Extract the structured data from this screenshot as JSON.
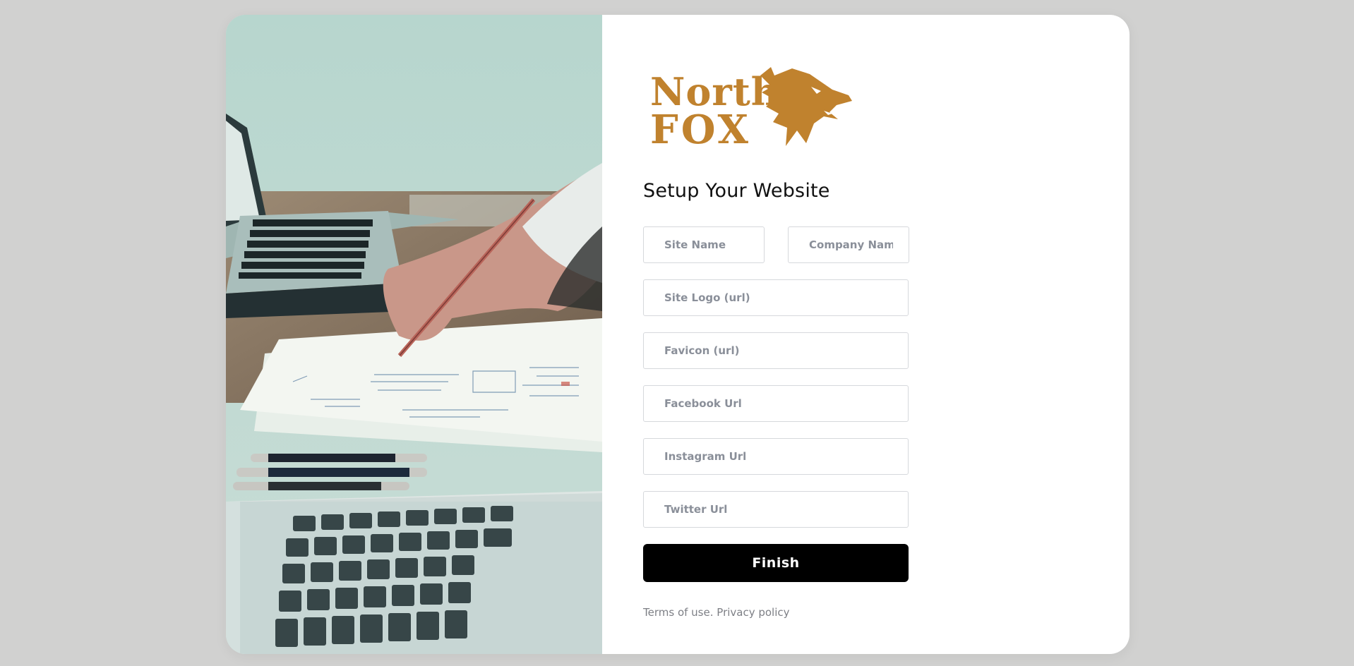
{
  "brand": {
    "logo_line1": "North",
    "logo_line2": "FOX",
    "logo_color": "#c0822e"
  },
  "page": {
    "heading": "Setup Your Website"
  },
  "form": {
    "site_name": {
      "placeholder": "Site Name",
      "value": ""
    },
    "company_name": {
      "placeholder": "Company Name",
      "value": ""
    },
    "site_logo": {
      "placeholder": "Site Logo (url)",
      "value": ""
    },
    "favicon": {
      "placeholder": "Favicon (url)",
      "value": ""
    },
    "facebook": {
      "placeholder": "Facebook Url",
      "value": ""
    },
    "instagram": {
      "placeholder": "Instagram Url",
      "value": ""
    },
    "twitter": {
      "placeholder": "Twitter Url",
      "value": ""
    },
    "submit_label": "Finish"
  },
  "footer": {
    "terms": "Terms of use.",
    "privacy": "Privacy policy"
  },
  "colors": {
    "background": "#d1d1d0",
    "card": "#ffffff",
    "button": "#000000",
    "muted_text": "#7d7f85"
  }
}
